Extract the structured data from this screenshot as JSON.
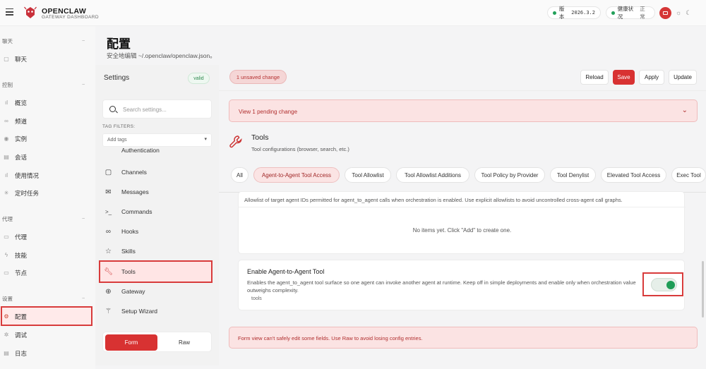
{
  "app": {
    "brand": "OPENCLAW",
    "brand_sub": "GATEWAY DASHBOARD",
    "version_label": "版本",
    "version_value": "2026.3.2",
    "health_label": "健康状况",
    "health_value": "正常",
    "theme_icons": [
      "monitor-icon",
      "sun-icon",
      "moon-icon"
    ]
  },
  "nav": {
    "groups": [
      {
        "label": "聊天",
        "items": [
          {
            "label": "聊天",
            "icon": "chat-icon"
          }
        ]
      },
      {
        "label": "控制",
        "items": [
          {
            "label": "概览",
            "icon": "bar-chart-icon"
          },
          {
            "label": "频道",
            "icon": "link-icon"
          },
          {
            "label": "实例",
            "icon": "radio-icon"
          },
          {
            "label": "会话",
            "icon": "file-icon"
          },
          {
            "label": "使用情况",
            "icon": "bar-chart-icon"
          },
          {
            "label": "定时任务",
            "icon": "loader-icon"
          }
        ]
      },
      {
        "label": "代理",
        "items": [
          {
            "label": "代理",
            "icon": "folder-icon"
          },
          {
            "label": "技能",
            "icon": "zap-icon"
          },
          {
            "label": "节点",
            "icon": "monitor-icon"
          }
        ]
      },
      {
        "label": "设置",
        "items": [
          {
            "label": "配置",
            "icon": "gear-icon",
            "active": true
          },
          {
            "label": "调试",
            "icon": "bug-icon"
          },
          {
            "label": "日志",
            "icon": "file-icon"
          }
        ]
      }
    ]
  },
  "page": {
    "title": "配置",
    "subtitle": "安全地编辑 ~/.openclaw/openclaw.json。"
  },
  "settings": {
    "title": "Settings",
    "valid_badge": "valid",
    "search_placeholder": "Search settings...",
    "tag_filters_label": "TAG FILTERS:",
    "add_tags_placeholder": "Add tags",
    "partial_section": "Authentication",
    "sections": [
      {
        "label": "Channels",
        "icon": "chat-icon"
      },
      {
        "label": "Messages",
        "icon": "mail-icon"
      },
      {
        "label": "Commands",
        "icon": "terminal-icon"
      },
      {
        "label": "Hooks",
        "icon": "link-icon"
      },
      {
        "label": "Skills",
        "icon": "star-icon"
      },
      {
        "label": "Tools",
        "icon": "wrench-icon",
        "active": true
      },
      {
        "label": "Gateway",
        "icon": "globe-icon"
      },
      {
        "label": "Setup Wizard",
        "icon": "wand-icon"
      }
    ],
    "mode_form": "Form",
    "mode_raw": "Raw"
  },
  "toolbar": {
    "unsaved": "1 unsaved change",
    "reload": "Reload",
    "save": "Save",
    "apply": "Apply",
    "update": "Update"
  },
  "pending": {
    "label": "View 1 pending change"
  },
  "tools": {
    "title": "Tools",
    "subtitle": "Tool configurations (browser, search, etc.)",
    "tabs": [
      "All",
      "Agent-to-Agent Tool Access",
      "Tool Allowlist",
      "Tool Allowlist Additions",
      "Tool Policy by Provider",
      "Tool Denylist",
      "Elevated Tool Access",
      "Exec Tool"
    ],
    "active_tab": "Agent-to-Agent Tool Access"
  },
  "allowlist": {
    "description": "Allowlist of target agent IDs permitted for agent_to_agent calls when orchestration is enabled. Use explicit allowlists to avoid uncontrolled cross-agent call graphs.",
    "empty": "No items yet. Click \"Add\" to create one."
  },
  "enable_a2a": {
    "title": "Enable Agent-to-Agent Tool",
    "description": "Enables the agent_to_agent tool surface so one agent can invoke another agent at runtime. Keep off in simple deployments and enable only when orchestration value outweighs complexity.",
    "tag": "tools",
    "enabled": true
  },
  "warning": "Form view can't safely edit some fields. Use Raw to avoid losing config entries.",
  "colors": {
    "accent": "#d83232",
    "success": "#1f9d57",
    "highlight_border": "#d83b3b"
  }
}
